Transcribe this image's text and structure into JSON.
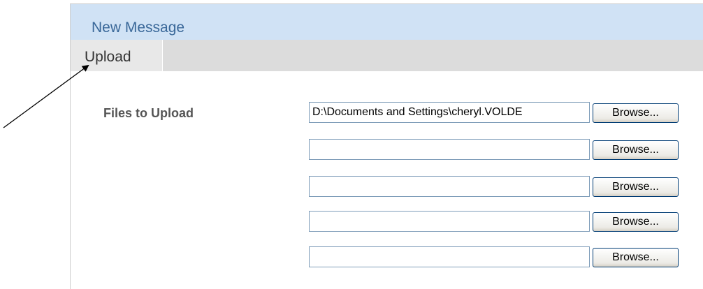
{
  "header": {
    "title": "New Message"
  },
  "tabs": [
    {
      "label": "Upload",
      "selected": true
    }
  ],
  "upload": {
    "label": "Files to Upload",
    "files": [
      {
        "value": "D:\\Documents and Settings\\cheryl.VOLDE",
        "button": "Browse..."
      },
      {
        "value": "",
        "button": "Browse..."
      },
      {
        "value": "",
        "button": "Browse..."
      },
      {
        "value": "",
        "button": "Browse..."
      },
      {
        "value": "",
        "button": "Browse..."
      }
    ]
  },
  "colors": {
    "title_bar": "#d0e2f5",
    "title_text": "#3a6899",
    "tab_bar": "#dcdcdc",
    "input_border": "#7f9db9"
  },
  "annotation": {
    "icon": "arrow-annotation-icon"
  }
}
